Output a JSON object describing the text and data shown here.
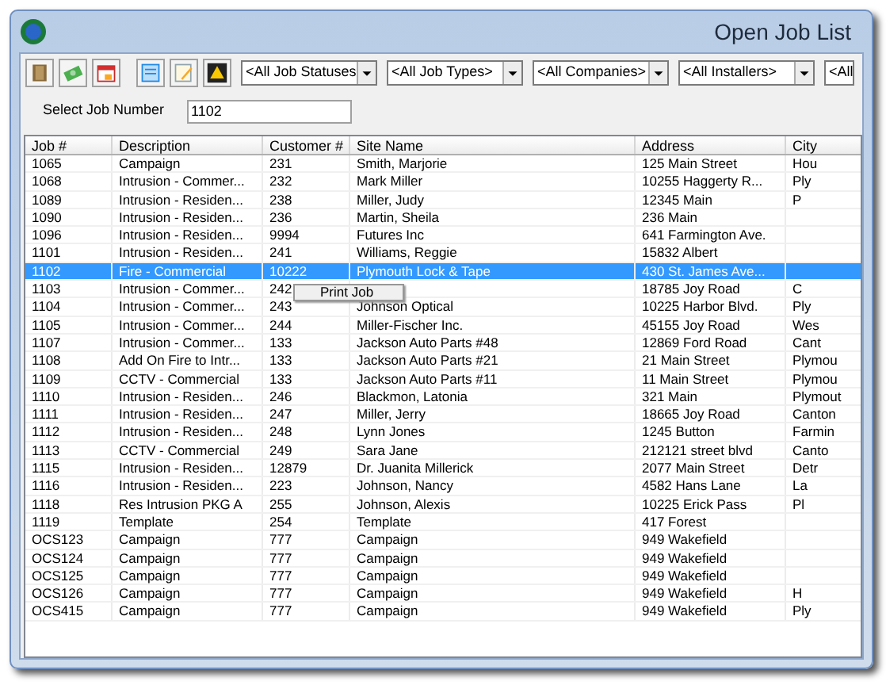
{
  "window": {
    "title": "Open Job List"
  },
  "filters": [
    "<All Job Statuses",
    "<All Job Types>",
    "<All Companies>",
    "<All Installers>",
    "<All"
  ],
  "job_number": {
    "label": "Select Job Number",
    "value": "1102"
  },
  "table": {
    "columns": [
      "Job #",
      "Description",
      "Customer #",
      "Site Name",
      "Address",
      "City"
    ],
    "rows": [
      {
        "selected": false,
        "cells": [
          "1065",
          "Campaign",
          "231",
          "Smith, Marjorie",
          "125 Main Street",
          "Hou"
        ]
      },
      {
        "selected": false,
        "cells": [
          "1068",
          "Intrusion - Commer...",
          "232",
          "Mark Miller",
          "10255 Haggerty R...",
          "Ply"
        ]
      },
      {
        "selected": false,
        "cells": [
          "1089",
          "Intrusion - Residen...",
          "238",
          "Miller, Judy",
          "12345 Main",
          "P"
        ]
      },
      {
        "selected": false,
        "cells": [
          "1090",
          "Intrusion - Residen...",
          "236",
          "Martin, Sheila",
          "236 Main"
        ]
      },
      {
        "selected": false,
        "cells": [
          "1096",
          "Intrusion - Residen...",
          "9994",
          "Futures  Inc",
          "641 Farmington Ave."
        ]
      },
      {
        "selected": false,
        "cells": [
          "1101",
          "Intrusion - Residen...",
          "241",
          "Williams, Reggie",
          "15832 Albert"
        ]
      },
      {
        "selected": true,
        "cells": [
          "1102",
          "Fire - Commercial",
          "10222",
          "Plymouth Lock & Tape",
          "430 St. James Ave..."
        ]
      },
      {
        "selected": false,
        "cells": [
          "1103",
          "Intrusion - Commer...",
          "242",
          "",
          "18785 Joy Road",
          "C"
        ]
      },
      {
        "selected": false,
        "cells": [
          "1104",
          "Intrusion - Commer...",
          "243",
          "Johnson Optical",
          "10225 Harbor Blvd.",
          "Ply"
        ]
      },
      {
        "selected": false,
        "cells": [
          "1105",
          "Intrusion - Commer...",
          "244",
          "Miller-Fischer Inc.",
          "45155 Joy Road",
          "Wes"
        ]
      },
      {
        "selected": false,
        "cells": [
          "1107",
          "Intrusion - Commer...",
          "133",
          "Jackson Auto Parts #48",
          "12869 Ford Road",
          "Cant"
        ]
      },
      {
        "selected": false,
        "cells": [
          "1108",
          "Add On Fire to Intr...",
          "133",
          "Jackson Auto Parts #21",
          "21 Main Street",
          "Plymou"
        ]
      },
      {
        "selected": false,
        "cells": [
          "1109",
          "CCTV - Commercial",
          "133",
          "Jackson Auto Parts #11",
          "11 Main Street",
          "Plymou"
        ]
      },
      {
        "selected": false,
        "cells": [
          "1110",
          "Intrusion - Residen...",
          "246",
          "Blackmon, Latonia",
          "321 Main",
          "Plymout"
        ]
      },
      {
        "selected": false,
        "cells": [
          "1111",
          "Intrusion - Residen...",
          "247",
          "Miller, Jerry",
          "18665 Joy Road",
          "Canton"
        ]
      },
      {
        "selected": false,
        "cells": [
          "1112",
          "Intrusion - Residen...",
          "248",
          "Lynn Jones",
          "1245 Button",
          "Farmin"
        ]
      },
      {
        "selected": false,
        "cells": [
          "1113",
          "CCTV - Commercial",
          "249",
          "Sara Jane",
          "212121 street blvd",
          "Canto"
        ]
      },
      {
        "selected": false,
        "cells": [
          "1115",
          "Intrusion - Residen...",
          "12879",
          "Dr. Juanita Millerick",
          "2077 Main Street",
          "Detr"
        ]
      },
      {
        "selected": false,
        "cells": [
          "1116",
          "Intrusion - Residen...",
          "223",
          "Johnson, Nancy",
          "4582 Hans Lane",
          "La"
        ]
      },
      {
        "selected": false,
        "cells": [
          "1118",
          "Res Intrusion PKG A",
          "255",
          "Johnson, Alexis",
          "10225 Erick Pass",
          "Pl"
        ]
      },
      {
        "selected": false,
        "cells": [
          "1119",
          "Template",
          "254",
          "Template",
          "417 Forest"
        ]
      },
      {
        "selected": false,
        "cells": [
          "OCS123",
          "Campaign",
          "777",
          "Campaign",
          "949 Wakefield"
        ]
      },
      {
        "selected": false,
        "cells": [
          "OCS124",
          "Campaign",
          "777",
          "Campaign",
          "949 Wakefield"
        ]
      },
      {
        "selected": false,
        "cells": [
          "OCS125",
          "Campaign",
          "777",
          "Campaign",
          "949 Wakefield"
        ]
      },
      {
        "selected": false,
        "cells": [
          "OCS126",
          "Campaign",
          "777",
          "Campaign",
          "949 Wakefield",
          "H"
        ]
      },
      {
        "selected": false,
        "cells": [
          "OCS415",
          "Campaign",
          "777",
          "Campaign",
          "949 Wakefield",
          "Ply"
        ]
      }
    ]
  },
  "context_menu": {
    "items": [
      "Print Job"
    ]
  }
}
